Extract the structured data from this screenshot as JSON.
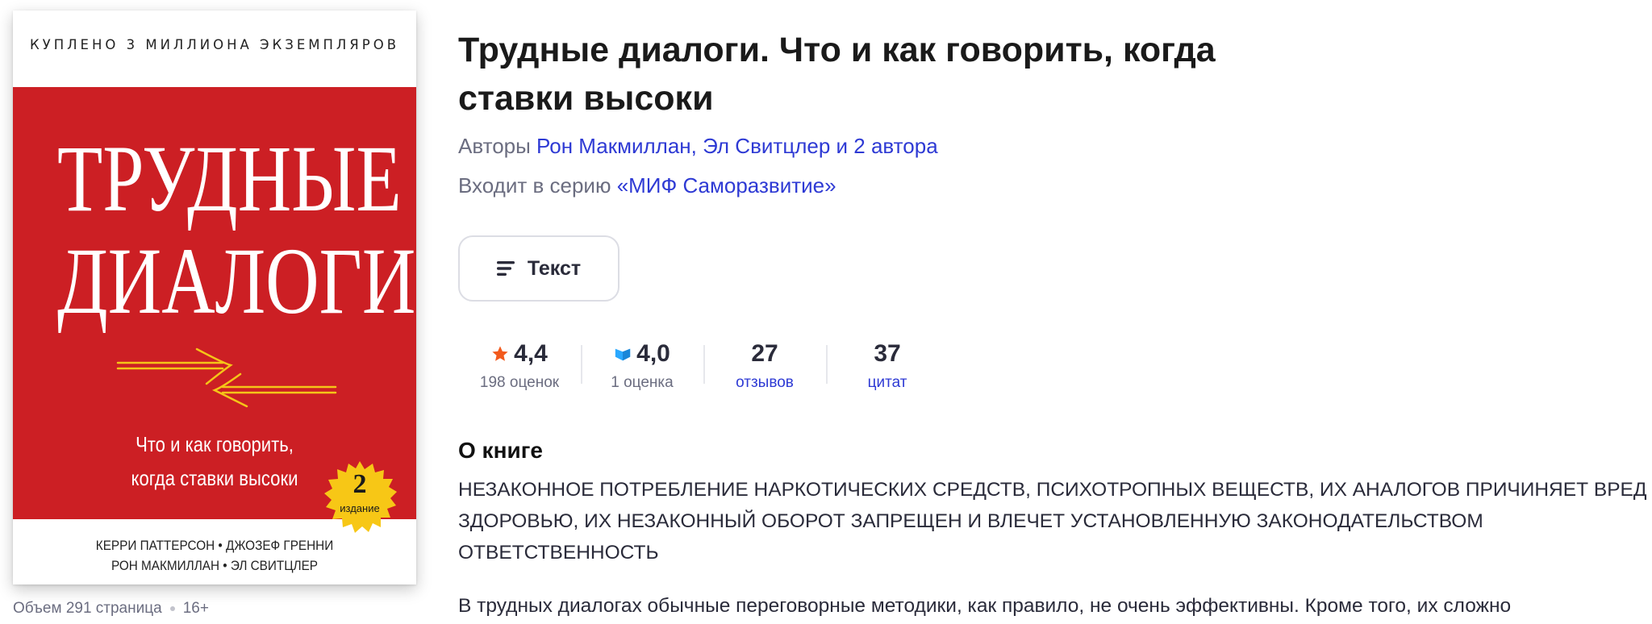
{
  "cover": {
    "tagline": "КУПЛЕНО 3 МИЛЛИОНА ЭКЗЕМПЛЯРОВ",
    "title_line1": "ТРУДНЫЕ",
    "title_line2": "ДИАЛОГИ",
    "subtitle_line1": "Что и как говорить,",
    "subtitle_line2": "когда ставки высоки",
    "badge_number": "2",
    "badge_text": "издание",
    "authors_line1": "КЕРРИ ПАТТЕРСОН • ДЖОЗЕФ ГРЕННИ",
    "authors_line2": "РОН МАКМИЛЛАН • ЭЛ СВИТЦЛЕР",
    "colors": {
      "red": "#cc1f24",
      "badge": "#f7c716",
      "arrows": "#f5c518"
    }
  },
  "meta": {
    "volume": "Объем 291 страница",
    "age": "16+"
  },
  "book": {
    "title": "Трудные диалоги. Что и как говорить, когда ставки высоки",
    "authors_label": "Авторы",
    "authors_link": "Рон Макмиллан, Эл Свитцлер и 2 автора",
    "series_label": "Входит в серию",
    "series_link": "«МИФ Саморазвитие»"
  },
  "format_button": {
    "label": "Текст",
    "icon": "text-lines-icon"
  },
  "stats": {
    "rating": {
      "value": "4,4",
      "label": "198 оценок",
      "icon": "star-icon",
      "color": "#f25a1d"
    },
    "bookmate": {
      "value": "4,0",
      "label": "1 оценка",
      "icon": "bookmate-icon",
      "color": "#2aa8ff"
    },
    "reviews": {
      "value": "27",
      "label": "отзывов"
    },
    "quotes": {
      "value": "37",
      "label": "цитат"
    }
  },
  "about": {
    "heading": "О книге",
    "warning": "НЕЗАКОННОЕ ПОТРЕБЛЕНИЕ НАРКОТИЧЕСКИХ СРЕДСТВ, ПСИХОТРОПНЫХ ВЕЩЕСТВ, ИХ АНАЛОГОВ ПРИЧИНЯЕТ ВРЕД ЗДОРОВЬЮ, ИХ НЕЗАКОННЫЙ ОБОРОТ ЗАПРЕЩЕН И ВЛЕЧЕТ УСТАНОВЛЕННУЮ ЗАКОНОДАТЕЛЬСТВОМ ОТВЕТСТВЕННОСТЬ",
    "description": "В трудных диалогах обычные переговорные методики, как правило, не очень эффективны. Кроме того, их сложно"
  },
  "colors": {
    "link": "#2e3ad4",
    "muted": "#6b6d80",
    "text": "#2a2b3a"
  }
}
